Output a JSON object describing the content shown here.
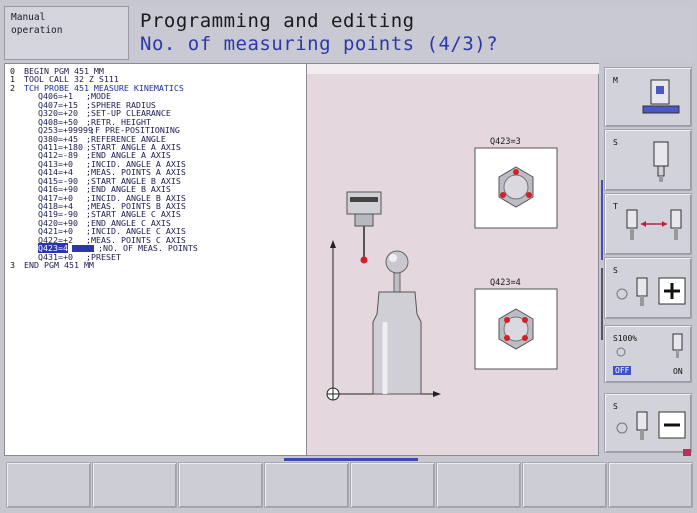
{
  "header": {
    "mode_line1": "Manual",
    "mode_line2": "operation",
    "title": "Programming and editing",
    "prompt": "No. of measuring points (4/3)?"
  },
  "program": {
    "lines": [
      {
        "num": "0",
        "text": "BEGIN PGM 451 MM",
        "style": "dark"
      },
      {
        "num": "1",
        "text": "TOOL CALL 32 Z S111",
        "style": "dark"
      },
      {
        "num": "2",
        "text": "TCH PROBE 451 MEASURE KINEMATICS",
        "style": "blue"
      },
      {
        "num": "",
        "param": "Q406=+1",
        "comment": ";MODE"
      },
      {
        "num": "",
        "param": "Q407=+15",
        "comment": ";SPHERE RADIUS"
      },
      {
        "num": "",
        "param": "Q320=+20",
        "comment": ";SET-UP CLEARANCE"
      },
      {
        "num": "",
        "param": "Q408=+50",
        "comment": ";RETR. HEIGHT"
      },
      {
        "num": "",
        "param": "Q253=+99999",
        "comment": ";F PRE-POSITIONING"
      },
      {
        "num": "",
        "param": "Q380=+45",
        "comment": ";REFERENCE ANGLE"
      },
      {
        "num": "",
        "param": "Q411=+180",
        "comment": ";START ANGLE A AXIS"
      },
      {
        "num": "",
        "param": "Q412=-89",
        "comment": ";END ANGLE A AXIS"
      },
      {
        "num": "",
        "param": "Q413=+0",
        "comment": ";INCID. ANGLE A AXIS"
      },
      {
        "num": "",
        "param": "Q414=+4",
        "comment": ";MEAS. POINTS A AXIS"
      },
      {
        "num": "",
        "param": "Q415=-90",
        "comment": ";START ANGLE B AXIS"
      },
      {
        "num": "",
        "param": "Q416=+90",
        "comment": ";END ANGLE B AXIS"
      },
      {
        "num": "",
        "param": "Q417=+0",
        "comment": ";INCID. ANGLE B AXIS"
      },
      {
        "num": "",
        "param": "Q418=+4",
        "comment": ";MEAS. POINTS B AXIS"
      },
      {
        "num": "",
        "param": "Q419=-90",
        "comment": ";START ANGLE C AXIS"
      },
      {
        "num": "",
        "param": "Q420=+90",
        "comment": ";END ANGLE C AXIS"
      },
      {
        "num": "",
        "param": "Q421=+0",
        "comment": ";INCID. ANGLE C AXIS"
      },
      {
        "num": "",
        "param": "Q422=+2",
        "comment": ";MEAS. POINTS C AXIS"
      },
      {
        "num": "",
        "param": "Q423=4",
        "comment": ";NO. OF MEAS. POINTS",
        "active": true
      },
      {
        "num": "",
        "param": "Q431=+0",
        "comment": ";PRESET"
      },
      {
        "num": "3",
        "text": "END PGM 451 MM",
        "style": "dark"
      }
    ]
  },
  "graphic": {
    "label_top": "Q423=3",
    "label_bottom": "Q423=4"
  },
  "side_keys": [
    {
      "letter": "M",
      "icon": "machine-icon"
    },
    {
      "letter": "S",
      "icon": "tool-icon"
    },
    {
      "letter": "T",
      "icon": "tool-exchange-icon"
    },
    {
      "letter": "S",
      "icon": "spindle-plus-icon"
    },
    {
      "value": "S100%",
      "off_label": "OFF",
      "on_label": "ON",
      "icon": "spindle-on-off-icon"
    },
    {
      "letter": "S",
      "icon": "spindle-minus-icon"
    }
  ],
  "colors": {
    "prompt_blue": "#2b39a8",
    "highlight": "#2c36b0",
    "probe_tip": "#d0202a"
  }
}
